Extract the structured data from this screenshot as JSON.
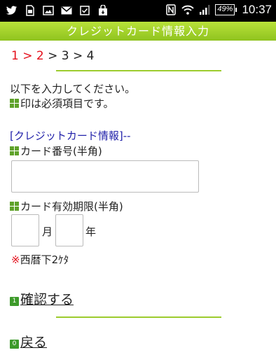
{
  "status_bar": {
    "icons": [
      "twitter-icon",
      "sim-icon",
      "image-icon",
      "gmail-icon",
      "checkbox-icon",
      "bag-icon",
      "nfc-icon",
      "wifi-icon",
      "signal-icon"
    ],
    "battery": "49%",
    "time": "10:37"
  },
  "header": {
    "title": "クレジットカード情報入力"
  },
  "steps": {
    "s1": "1",
    "sep1": ">",
    "s2": "2",
    "sep2": ">",
    "s3": "3",
    "sep3": ">",
    "s4": "4"
  },
  "intro": {
    "line1": "以下を入力してください。",
    "line2": "印は必須項目です。"
  },
  "section": {
    "title": "[クレジットカード情報]--"
  },
  "card_number": {
    "label": "カード番号(半角)",
    "value": "",
    "placeholder": ""
  },
  "expiry": {
    "label": "カード有効期限(半角)",
    "month_value": "",
    "month_label": "月",
    "year_value": "",
    "year_label": "年"
  },
  "note": {
    "asterisk": "※",
    "text": "西暦下2ｹﾀ"
  },
  "actions": {
    "confirm": {
      "key": "1",
      "label": "確認する"
    },
    "back": {
      "key": "0",
      "label": "戻る"
    }
  },
  "colors": {
    "accent_green": "#8fc31f",
    "mark_green": "#5fa22a",
    "step_active": "#e4101c",
    "section_blue": "#2222aa"
  }
}
